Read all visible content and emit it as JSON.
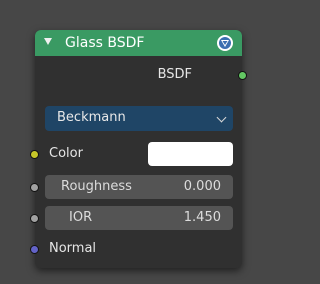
{
  "node": {
    "title": "Glass BSDF",
    "header_color": "#3a9a63",
    "output": {
      "label": "BSDF",
      "socket_color": "#63c763"
    },
    "distribution": {
      "selected": "Beckmann"
    },
    "inputs": {
      "color": {
        "label": "Color",
        "swatch": "#ffffff",
        "socket_color": "#c7c729"
      },
      "roughness": {
        "label": "Roughness",
        "value": "0.000",
        "socket_color": "#a1a1a1"
      },
      "ior": {
        "label": "IOR",
        "value": "1.450",
        "socket_color": "#a1a1a1"
      },
      "normal": {
        "label": "Normal",
        "socket_color": "#6363c7"
      }
    }
  }
}
